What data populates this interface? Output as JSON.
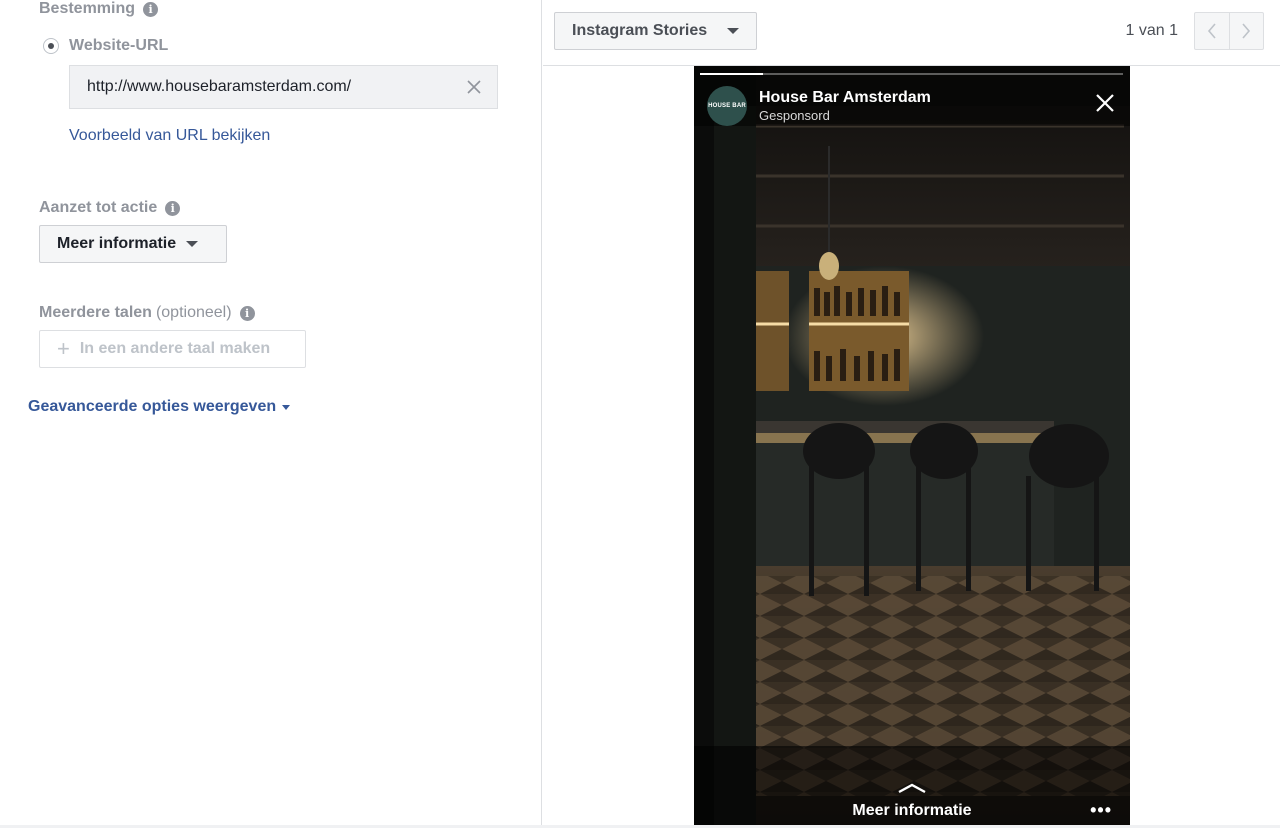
{
  "destination": {
    "label": "Bestemming",
    "radio_label": "Website-URL",
    "url_value": "http://www.housebaramsterdam.com/",
    "preview_link": "Voorbeeld van URL bekijken"
  },
  "cta": {
    "label": "Aanzet tot actie",
    "selected": "Meer informatie"
  },
  "languages": {
    "label": "Meerdere talen",
    "optional": "(optioneel)",
    "button": "In een andere taal maken"
  },
  "advanced_link": "Geavanceerde opties weergeven",
  "preview": {
    "placement": "Instagram Stories",
    "pager_text": "1 van 1",
    "story": {
      "progress": 0.15,
      "avatar_text": "HOUSE BAR",
      "account_name": "House Bar Amsterdam",
      "subtitle": "Gesponsord",
      "cta_label": "Meer informatie",
      "more": "•••"
    }
  },
  "colors": {
    "link": "#365899",
    "avatar_bg": "#2e504c",
    "muted": "#90949c"
  }
}
